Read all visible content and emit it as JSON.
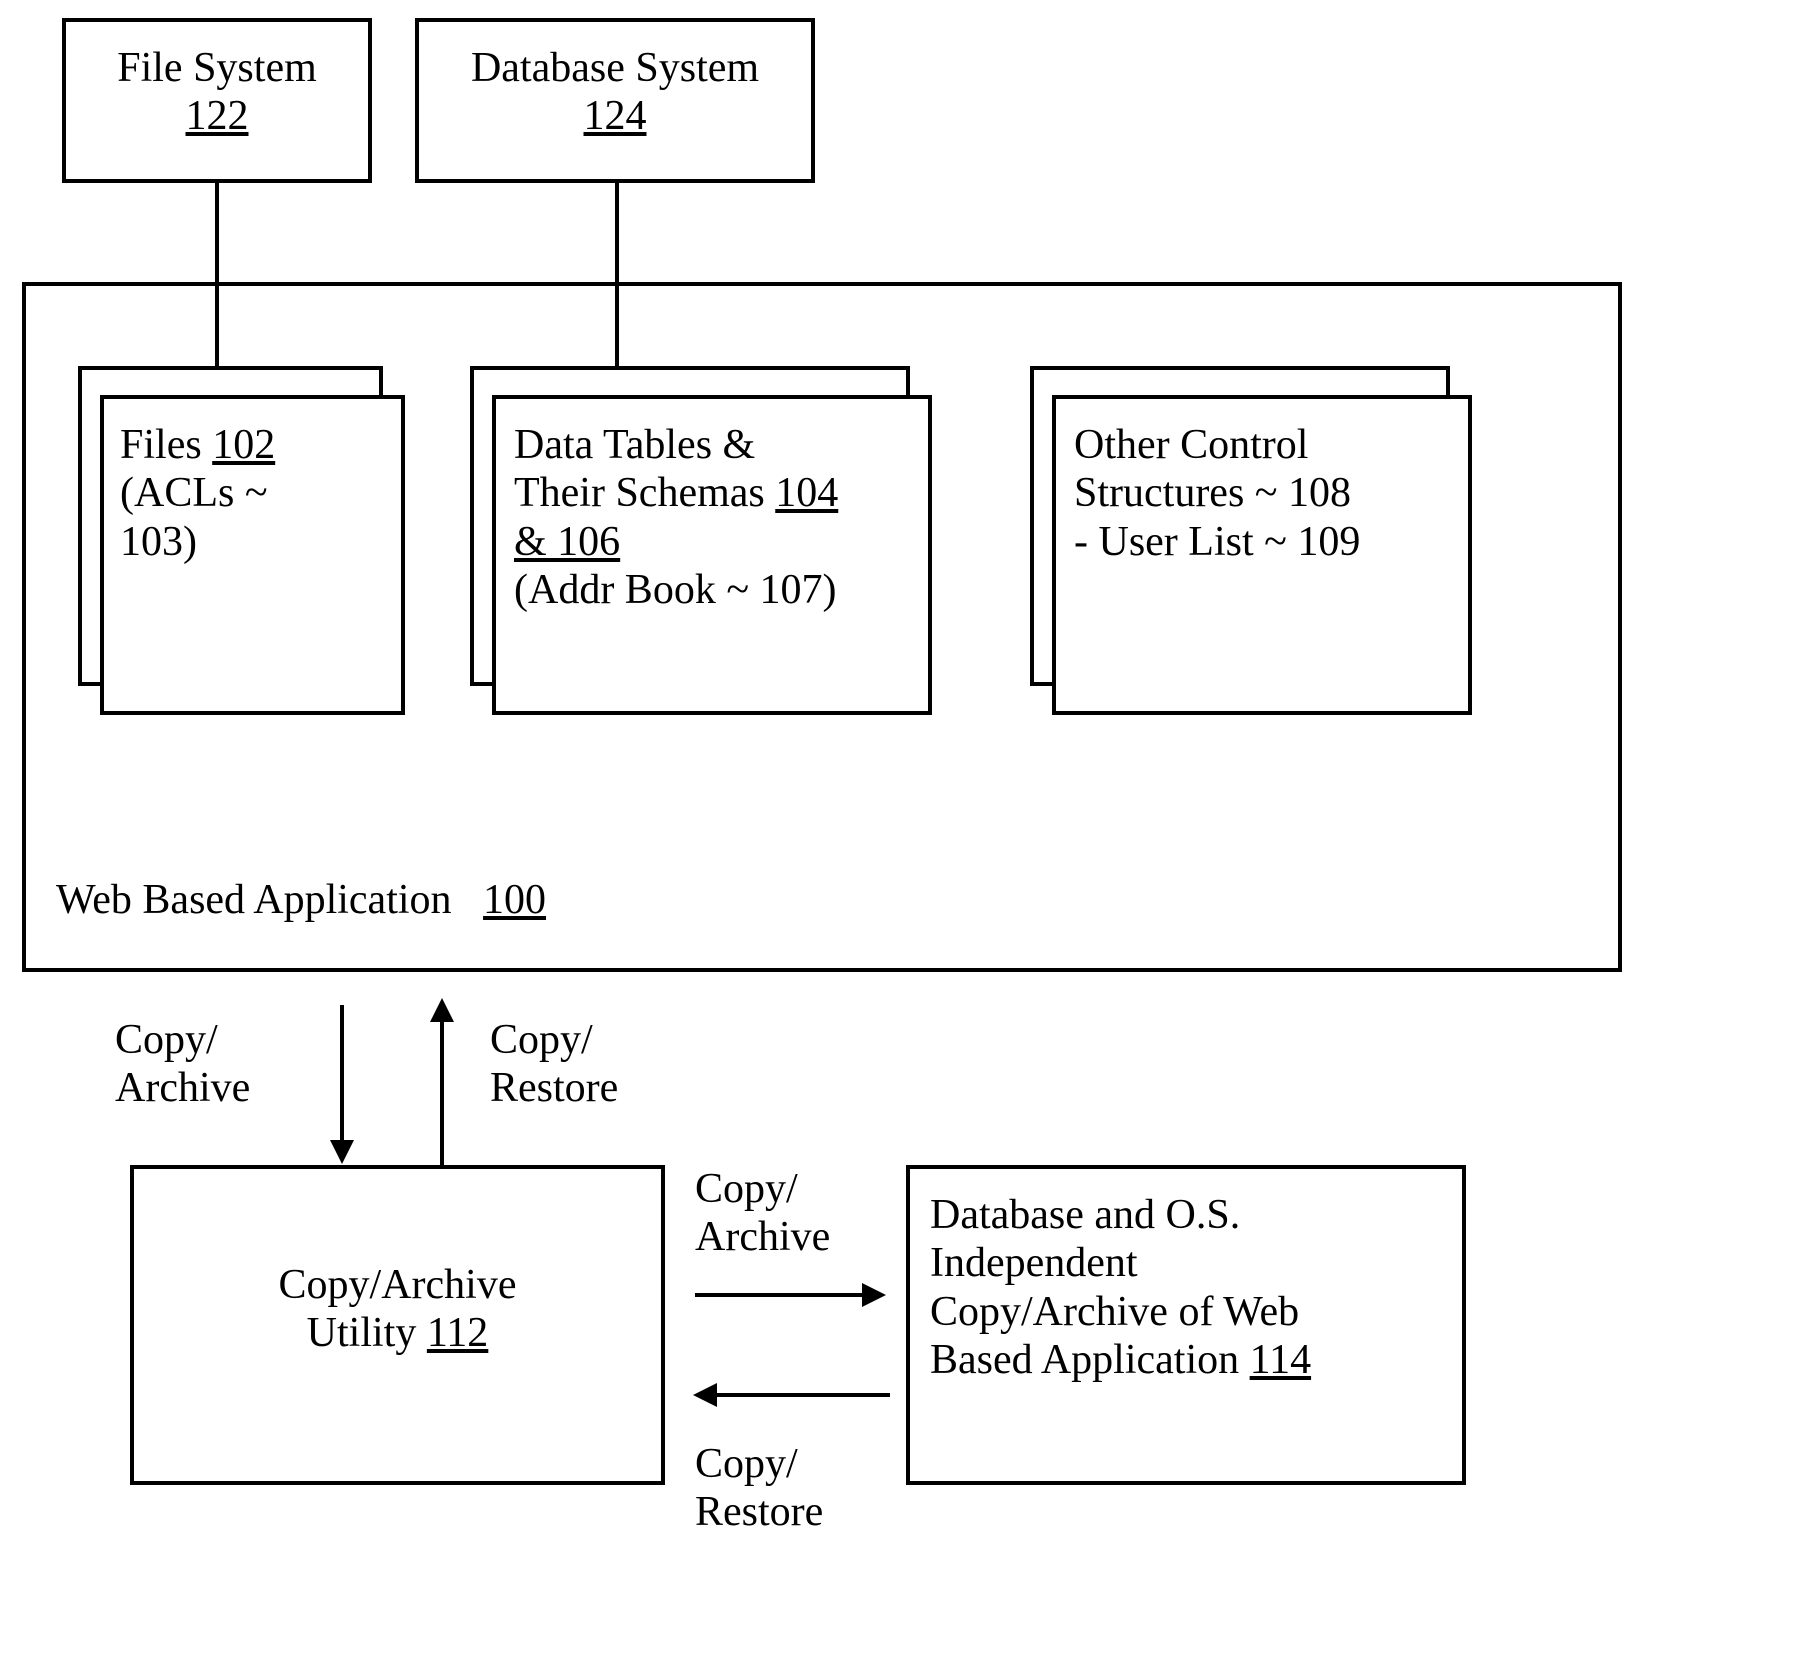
{
  "fileSystem": {
    "title": "File System",
    "ref": "122"
  },
  "databaseSystem": {
    "title": "Database System",
    "ref": "124"
  },
  "webApp": {
    "title": "Web Based Application",
    "ref": "100"
  },
  "files": {
    "line1_pre": "Files ",
    "line1_ref": "102",
    "line2": "(ACLs ~",
    "line3": "103)"
  },
  "dataTables": {
    "line1": "Data Tables &",
    "line2_pre": "Their Schemas ",
    "line2_ref": "104",
    "line3_pre": "",
    "line3_ref": "& 106",
    "line4": "(Addr Book ~ 107)"
  },
  "otherControl": {
    "line1": "Other Control",
    "line2": "Structures ~ 108",
    "line3": "- User List ~ 109"
  },
  "copyArchiveLabel": {
    "line1": "Copy/",
    "line2": "Archive"
  },
  "copyRestoreLabel": {
    "line1": "Copy/",
    "line2": "Restore"
  },
  "utility": {
    "line1": "Copy/Archive",
    "line2_pre": "Utility ",
    "line2_ref": "112"
  },
  "output": {
    "line1": "Database and O.S.",
    "line2": "Independent",
    "line3": "Copy/Archive of Web",
    "line4_pre": "Based Application ",
    "line4_ref": "114"
  }
}
